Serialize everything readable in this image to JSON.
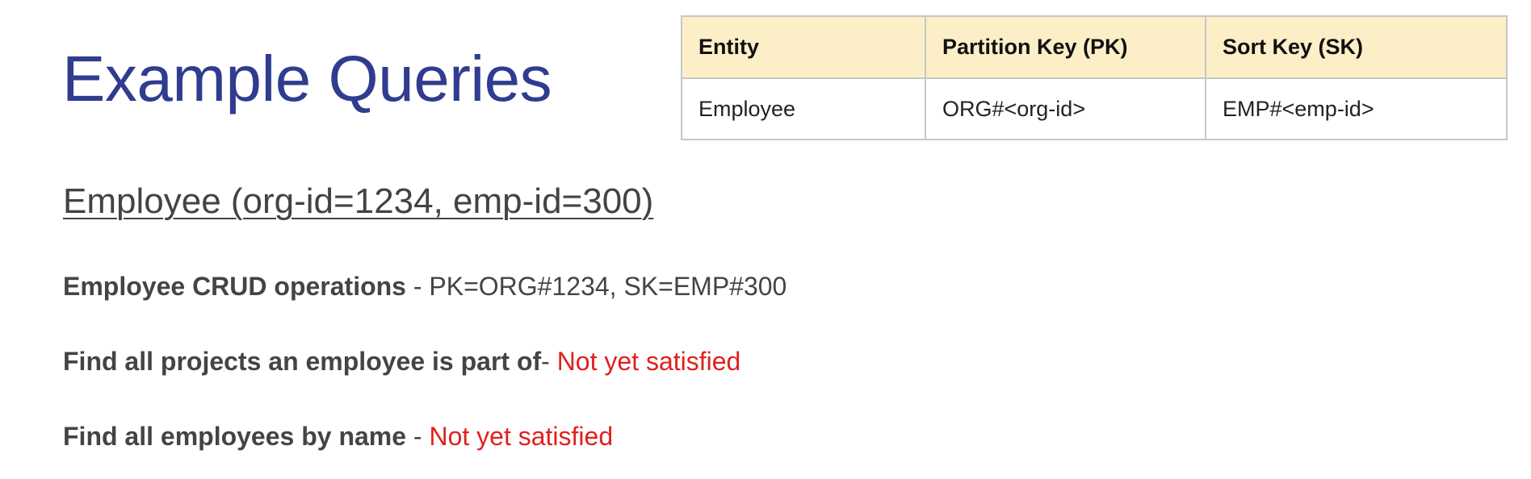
{
  "title": "Example Queries",
  "table": {
    "headers": [
      "Entity",
      "Partition Key (PK)",
      "Sort Key (SK)"
    ],
    "rows": [
      [
        "Employee",
        "ORG#<org-id>",
        "EMP#<emp-id>"
      ]
    ]
  },
  "subheading": "Employee (org-id=1234, emp-id=300)",
  "queries": [
    {
      "label": "Employee CRUD operations",
      "separator": " - ",
      "result": "PK=ORG#1234, SK=EMP#300",
      "result_color": "#444444"
    },
    {
      "label": "Find all projects an employee is part of",
      "separator": "- ",
      "result": "Not yet satisfied",
      "result_color": "#e0201e"
    },
    {
      "label": "Find all employees by name",
      "separator": " - ",
      "result": "Not yet satisfied",
      "result_color": "#e0201e"
    }
  ]
}
